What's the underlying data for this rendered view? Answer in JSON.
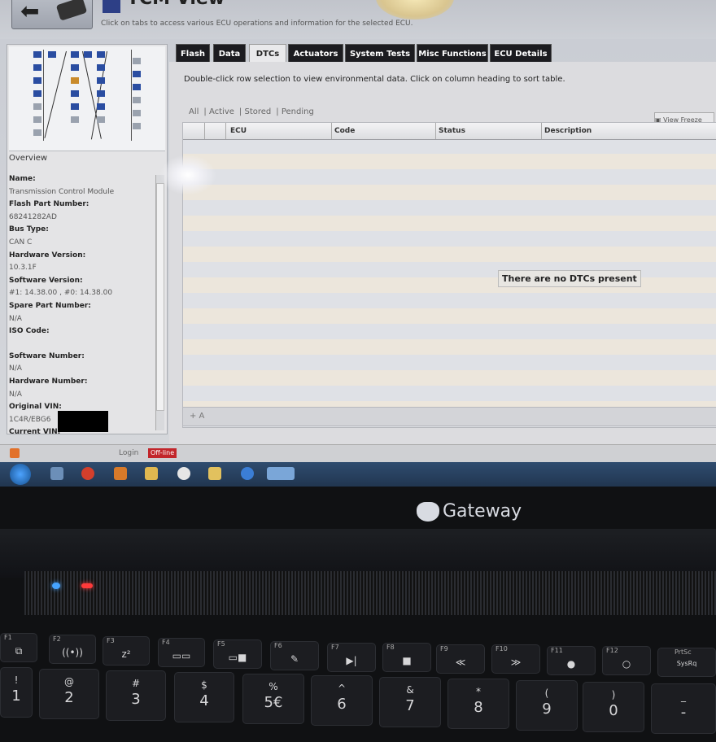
{
  "app": {
    "title": "TCM View",
    "subtitle": "Click on tabs to access various ECU operations and information for the selected ECU."
  },
  "tabs": [
    {
      "label": "Flash",
      "active": false
    },
    {
      "label": "Data",
      "active": false
    },
    {
      "label": "DTCs",
      "active": true
    },
    {
      "label": "Actuators",
      "active": false
    },
    {
      "label": "System Tests",
      "active": false
    },
    {
      "label": "Misc Functions",
      "active": false
    },
    {
      "label": "ECU Details",
      "active": false
    }
  ],
  "sidebar": {
    "overview_label": "Overview",
    "properties": [
      {
        "key": "Name:",
        "value": "Transmission Control Module"
      },
      {
        "key": "Flash Part Number:",
        "value": "68241282AD"
      },
      {
        "key": "Bus Type:",
        "value": "CAN C"
      },
      {
        "key": "Hardware Version:",
        "value": "10.3.1F"
      },
      {
        "key": "Software Version:",
        "value": "#1: 14.38.00 , #0: 14.38.00"
      },
      {
        "key": "Spare Part Number:",
        "value": "N/A"
      },
      {
        "key": "ISO Code:",
        "value": ""
      },
      {
        "key": "Software Number:",
        "value": "N/A"
      },
      {
        "key": "Hardware Number:",
        "value": "N/A"
      },
      {
        "key": "Original VIN:",
        "value": "1C4R/EBG6"
      },
      {
        "key": "Current VIN:",
        "value": ""
      }
    ]
  },
  "dtc": {
    "hint": "Double-click row selection to view environmental data.  Click on column heading to sort table.",
    "filters": [
      "All",
      "Active",
      "Stored",
      "Pending"
    ],
    "view_button": "View Freeze",
    "columns": [
      "ECU",
      "Code",
      "Status",
      "Description"
    ],
    "empty_message": "There are no DTCs present",
    "footer_controls": "+  A"
  },
  "status_bar": {
    "login": "Login",
    "offline": "Off-line"
  },
  "laptop": {
    "brand": "Gateway",
    "fkeys": [
      {
        "label": "F1",
        "icon": "⧉"
      },
      {
        "label": "F2",
        "icon": "((•))"
      },
      {
        "label": "F3",
        "icon": "z²"
      },
      {
        "label": "F4",
        "icon": "▭▭"
      },
      {
        "label": "F5",
        "icon": "▭■"
      },
      {
        "label": "F6",
        "icon": "✎"
      },
      {
        "label": "F7",
        "icon": "▶|"
      },
      {
        "label": "F8",
        "icon": "■"
      },
      {
        "label": "F9",
        "icon": "≪"
      },
      {
        "label": "F10",
        "icon": "≫"
      },
      {
        "label": "F11",
        "icon": "●"
      },
      {
        "label": "F12",
        "icon": "○"
      },
      {
        "label": "PrtSc",
        "icon": "SysRq"
      }
    ],
    "numkeys": [
      {
        "top": "!",
        "bottom": "1"
      },
      {
        "top": "@",
        "bottom": "2"
      },
      {
        "top": "#",
        "bottom": "3"
      },
      {
        "top": "$",
        "bottom": "4"
      },
      {
        "top": "%",
        "bottom": "5€"
      },
      {
        "top": "^",
        "bottom": "6"
      },
      {
        "top": "&",
        "bottom": "7"
      },
      {
        "top": "*",
        "bottom": "8"
      },
      {
        "top": "(",
        "bottom": "9"
      },
      {
        "top": ")",
        "bottom": "0"
      },
      {
        "top": "_",
        "bottom": "-"
      }
    ]
  },
  "colors": {
    "tab_bg": "#1c1c20",
    "offline_badge": "#c2262b",
    "taskbar": "#2f4c6f",
    "led_power": "#45a3ff",
    "led_status": "#ff3a3a"
  }
}
